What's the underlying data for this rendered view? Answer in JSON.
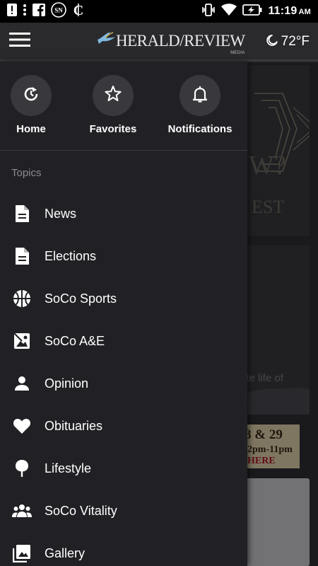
{
  "status_bar": {
    "time": "11:19",
    "ampm": "AM"
  },
  "header": {
    "brand_name": "HERALD/REVIEW",
    "brand_sub": "MEDIA",
    "temperature": "72°F"
  },
  "quick_links": [
    {
      "label": "Home",
      "icon": "home-refresh-icon"
    },
    {
      "label": "Favorites",
      "icon": "star-icon"
    },
    {
      "label": "Notifications",
      "icon": "bell-icon"
    }
  ],
  "topics_heading": "Topics",
  "topics": [
    {
      "label": "News",
      "icon": "document-icon"
    },
    {
      "label": "Elections",
      "icon": "document-icon"
    },
    {
      "label": "SoCo Sports",
      "icon": "basketball-icon"
    },
    {
      "label": "SoCo A&E",
      "icon": "image-icon"
    },
    {
      "label": "Opinion",
      "icon": "person-icon"
    },
    {
      "label": "Obituaries",
      "icon": "heart-icon"
    },
    {
      "label": "Lifestyle",
      "icon": "tree-icon"
    },
    {
      "label": "SoCo Vitality",
      "icon": "group-icon"
    },
    {
      "label": "Gallery",
      "icon": "gallery-icon"
    }
  ],
  "background": {
    "card1_text_a": "W?",
    "card1_text_b": "EST",
    "card2_text": "ate life of",
    "ad_line1": "8 & 29",
    "ad_line2": "2pm-11pm",
    "ad_line3": "HERE"
  },
  "colors": {
    "drawer_bg": "#212125",
    "app_bar": "#2a2a2d",
    "status_bar": "#000000",
    "text": "#ffffff",
    "muted": "#8b8b92"
  }
}
